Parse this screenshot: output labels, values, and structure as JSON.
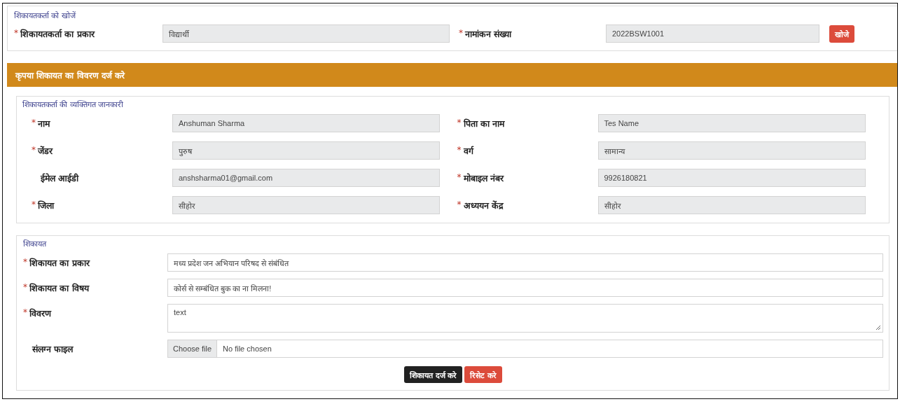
{
  "search": {
    "legend": "शिकायतकर्ता को खोजें",
    "fields": [
      {
        "label": "शिकायतकर्ता का प्रकार",
        "value": "विद्यार्थी",
        "marker": "*",
        "disabled": true
      },
      {
        "label": "नामांकन संख्या",
        "value": "2022BSW1001",
        "marker": "*",
        "disabled": true
      }
    ],
    "button": "खोजे"
  },
  "panel": {
    "title": "कृपया शिकायत का विवरण दर्ज करे"
  },
  "personal": {
    "legend": "शिकायतकर्ता की व्यक्तिगत जानकारी",
    "fields": [
      {
        "label": "नाम",
        "value": "Anshuman Sharma",
        "marker": "*",
        "disabled": true
      },
      {
        "label": "पिता का नाम",
        "value": "Tes Name",
        "marker": "*",
        "disabled": true
      },
      {
        "label": "जेंडर",
        "value": "पुरुष",
        "marker": "*",
        "disabled": true
      },
      {
        "label": "वर्ग",
        "value": "सामान्य",
        "marker": "*",
        "disabled": true
      },
      {
        "label": "ईमेल आईडी",
        "value": "anshsharma01@gmail.com",
        "disabled": true
      },
      {
        "label": "मोबाइल नंबर",
        "value": "9926180821",
        "marker": "*",
        "disabled": true
      },
      {
        "label": "जिला",
        "value": "सीहोर",
        "marker": "*",
        "disabled": true
      },
      {
        "label": "अध्ययन केंद्र",
        "value": "सीहोर",
        "marker": "*",
        "disabled": true
      }
    ]
  },
  "complaint": {
    "legend": "शिकायत",
    "fields": [
      {
        "kind": "text",
        "label": "शिकायत का प्रकार",
        "value": "मध्य प्रदेश जन अभियान परिषद से संबंधित",
        "marker": "*",
        "disabled": false
      },
      {
        "kind": "text",
        "label": "शिकायत का विषय",
        "value": "कोर्स से सम्बंधित बुक का ना मिलना!",
        "marker": "*",
        "disabled": false
      },
      {
        "kind": "textarea",
        "label": "विवरण",
        "value": "text",
        "marker": "*",
        "disabled": false
      },
      {
        "kind": "file",
        "label": "संलग्न फाइल",
        "button": "Choose file",
        "value": "No file chosen",
        "disabled": false
      }
    ]
  },
  "buttons": [
    {
      "label": "शिकायत दर्ज करे",
      "kind": "primary"
    },
    {
      "label": "रिसेट करे",
      "kind": "danger"
    }
  ]
}
